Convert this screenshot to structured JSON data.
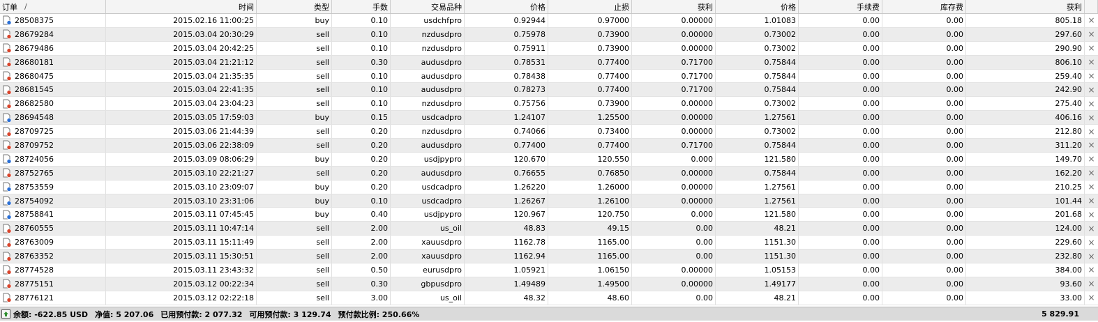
{
  "header": [
    {
      "label": "订单",
      "sort": "/"
    },
    {
      "label": "时间"
    },
    {
      "label": "类型"
    },
    {
      "label": "手数"
    },
    {
      "label": "交易品种"
    },
    {
      "label": "价格"
    },
    {
      "label": "止损"
    },
    {
      "label": "获利"
    },
    {
      "label": "价格"
    },
    {
      "label": "手续费"
    },
    {
      "label": "库存费"
    },
    {
      "label": "获利"
    }
  ],
  "rows": [
    [
      "28508375",
      "2015.02.16 11:00:25",
      "buy",
      "0.10",
      "usdchfpro",
      "0.92944",
      "0.97000",
      "0.00000",
      "1.01083",
      "0.00",
      "0.00",
      "805.18"
    ],
    [
      "28679284",
      "2015.03.04 20:30:29",
      "sell",
      "0.10",
      "nzdusdpro",
      "0.75978",
      "0.73900",
      "0.00000",
      "0.73002",
      "0.00",
      "0.00",
      "297.60"
    ],
    [
      "28679486",
      "2015.03.04 20:42:25",
      "sell",
      "0.10",
      "nzdusdpro",
      "0.75911",
      "0.73900",
      "0.00000",
      "0.73002",
      "0.00",
      "0.00",
      "290.90"
    ],
    [
      "28680181",
      "2015.03.04 21:21:12",
      "sell",
      "0.30",
      "audusdpro",
      "0.78531",
      "0.77400",
      "0.71700",
      "0.75844",
      "0.00",
      "0.00",
      "806.10"
    ],
    [
      "28680475",
      "2015.03.04 21:35:35",
      "sell",
      "0.10",
      "audusdpro",
      "0.78438",
      "0.77400",
      "0.71700",
      "0.75844",
      "0.00",
      "0.00",
      "259.40"
    ],
    [
      "28681545",
      "2015.03.04 22:41:35",
      "sell",
      "0.10",
      "audusdpro",
      "0.78273",
      "0.77400",
      "0.71700",
      "0.75844",
      "0.00",
      "0.00",
      "242.90"
    ],
    [
      "28682580",
      "2015.03.04 23:04:23",
      "sell",
      "0.10",
      "nzdusdpro",
      "0.75756",
      "0.73900",
      "0.00000",
      "0.73002",
      "0.00",
      "0.00",
      "275.40"
    ],
    [
      "28694548",
      "2015.03.05 17:59:03",
      "buy",
      "0.15",
      "usdcadpro",
      "1.24107",
      "1.25500",
      "0.00000",
      "1.27561",
      "0.00",
      "0.00",
      "406.16"
    ],
    [
      "28709725",
      "2015.03.06 21:44:39",
      "sell",
      "0.20",
      "nzdusdpro",
      "0.74066",
      "0.73400",
      "0.00000",
      "0.73002",
      "0.00",
      "0.00",
      "212.80"
    ],
    [
      "28709752",
      "2015.03.06 22:38:09",
      "sell",
      "0.20",
      "audusdpro",
      "0.77400",
      "0.77400",
      "0.71700",
      "0.75844",
      "0.00",
      "0.00",
      "311.20"
    ],
    [
      "28724056",
      "2015.03.09 08:06:29",
      "buy",
      "0.20",
      "usdjpypro",
      "120.670",
      "120.550",
      "0.000",
      "121.580",
      "0.00",
      "0.00",
      "149.70"
    ],
    [
      "28752765",
      "2015.03.10 22:21:27",
      "sell",
      "0.20",
      "audusdpro",
      "0.76655",
      "0.76850",
      "0.00000",
      "0.75844",
      "0.00",
      "0.00",
      "162.20"
    ],
    [
      "28753559",
      "2015.03.10 23:09:07",
      "buy",
      "0.20",
      "usdcadpro",
      "1.26220",
      "1.26000",
      "0.00000",
      "1.27561",
      "0.00",
      "0.00",
      "210.25"
    ],
    [
      "28754092",
      "2015.03.10 23:31:06",
      "buy",
      "0.10",
      "usdcadpro",
      "1.26267",
      "1.26100",
      "0.00000",
      "1.27561",
      "0.00",
      "0.00",
      "101.44"
    ],
    [
      "28758841",
      "2015.03.11 07:45:45",
      "buy",
      "0.40",
      "usdjpypro",
      "120.967",
      "120.750",
      "0.000",
      "121.580",
      "0.00",
      "0.00",
      "201.68"
    ],
    [
      "28760555",
      "2015.03.11 10:47:14",
      "sell",
      "2.00",
      "us_oil",
      "48.83",
      "49.15",
      "0.00",
      "48.21",
      "0.00",
      "0.00",
      "124.00"
    ],
    [
      "28763009",
      "2015.03.11 15:11:49",
      "sell",
      "2.00",
      "xauusdpro",
      "1162.78",
      "1165.00",
      "0.00",
      "1151.30",
      "0.00",
      "0.00",
      "229.60"
    ],
    [
      "28763352",
      "2015.03.11 15:30:51",
      "sell",
      "2.00",
      "xauusdpro",
      "1162.94",
      "1165.00",
      "0.00",
      "1151.30",
      "0.00",
      "0.00",
      "232.80"
    ],
    [
      "28774528",
      "2015.03.11 23:43:32",
      "sell",
      "0.50",
      "eurusdpro",
      "1.05921",
      "1.06150",
      "0.00000",
      "1.05153",
      "0.00",
      "0.00",
      "384.00"
    ],
    [
      "28775151",
      "2015.03.12 00:22:34",
      "sell",
      "0.30",
      "gbpusdpro",
      "1.49489",
      "1.49500",
      "0.00000",
      "1.49177",
      "0.00",
      "0.00",
      "93.60"
    ],
    [
      "28776121",
      "2015.03.12 02:22:18",
      "sell",
      "3.00",
      "us_oil",
      "48.32",
      "48.60",
      "0.00",
      "48.21",
      "0.00",
      "0.00",
      "33.00"
    ]
  ],
  "footer": {
    "balance": "余额: -622.85 USD",
    "equity": "净值: 5 207.06",
    "margin": "已用预付款: 2 077.32",
    "free_margin": "可用预付款: 3 129.74",
    "margin_level": "预付款比例: 250.66%",
    "total": "5 829.91"
  },
  "icons": {
    "buy": "buy-order-icon",
    "sell": "sell-order-icon",
    "close": "close-icon"
  },
  "colors": {
    "buy_dot": "#2a6fd6",
    "sell_dot": "#d9442b",
    "row_alt": "#ececec",
    "footer_bg": "#dadada"
  }
}
